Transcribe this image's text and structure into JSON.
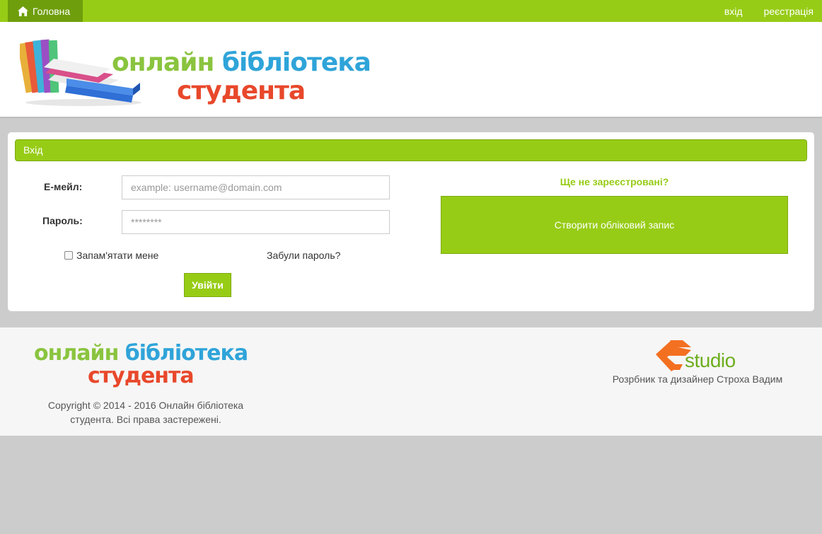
{
  "nav": {
    "home_label": "Головна",
    "login_link": "вхід",
    "register_link": "реєстрація"
  },
  "logo": {
    "line1_part1": "онлайн ",
    "line1_part2": "бібліотека",
    "line2": "студента"
  },
  "login": {
    "panel_title": "Вхід",
    "email_label": "Е-мейл:",
    "email_placeholder": "example: username@domain.com",
    "password_label": "Пароль:",
    "password_value": "********",
    "remember_label": "Запам'ятати мене",
    "remember_checked": false,
    "forgot_link": "Забули пароль?",
    "submit_label": "Увійти"
  },
  "signup": {
    "prompt": "Ще не зареєстровані?",
    "button_label": "Створити обліковий запис"
  },
  "footer": {
    "copyright": "Copyright © 2014 - 2016 Онлайн бібліотека студента. Всі права застережені.",
    "studio_logo_text": "studio",
    "designer": "Розрбник та дизайнер Строха Вадим"
  },
  "colors": {
    "accent_green": "#97cc16",
    "dark_green": "#6f9e0c",
    "logo_blue": "#2fa4d9",
    "logo_red": "#e8482b",
    "studio_orange": "#f37021"
  }
}
